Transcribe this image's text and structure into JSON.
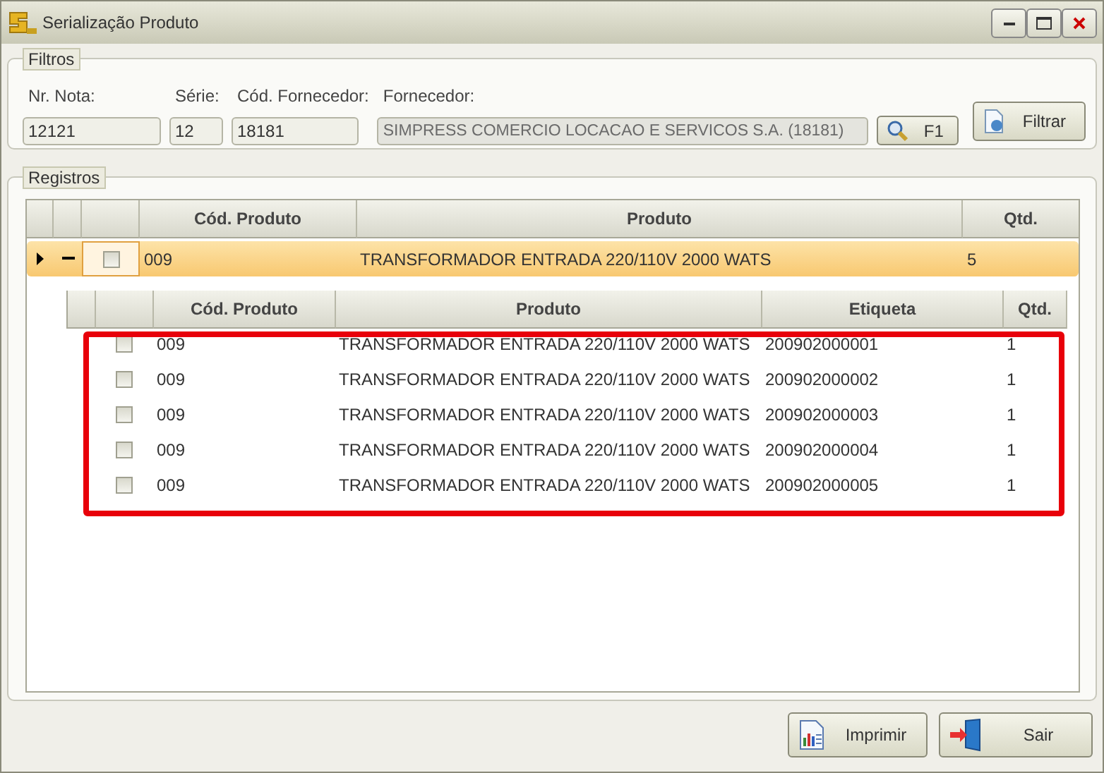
{
  "window": {
    "title": "Serialização Produto"
  },
  "filters": {
    "legend": "Filtros",
    "fields": [
      {
        "label": "Nr. Nota:",
        "value": "12121",
        "disabled": false
      },
      {
        "label": "Série:",
        "value": "12",
        "disabled": false
      },
      {
        "label": "Cód. Fornecedor:",
        "value": "18181",
        "disabled": false
      },
      {
        "label": "Fornecedor:",
        "value": "SIMPRESS COMERCIO LOCACAO E SERVICOS S.A. (18181)",
        "disabled": true
      }
    ],
    "lookup_button": "F1",
    "filter_button": "Filtrar"
  },
  "records": {
    "legend": "Registros",
    "columns": [
      "Cód. Produto",
      "Produto",
      "Qtd."
    ],
    "rows": [
      {
        "code": "009",
        "product": "TRANSFORMADOR ENTRADA 220/110V 2000 WATS",
        "qty": "5",
        "selected": true,
        "expanded": true,
        "checked": false,
        "child_columns": [
          "Cód. Produto",
          "Produto",
          "Etiqueta",
          "Qtd."
        ],
        "highlighted": true,
        "children": [
          {
            "code": "009",
            "product": "TRANSFORMADOR ENTRADA 220/110V 2000 WATS",
            "label": "200902000001",
            "qty": "1",
            "checked": false
          },
          {
            "code": "009",
            "product": "TRANSFORMADOR ENTRADA 220/110V 2000 WATS",
            "label": "200902000002",
            "qty": "1",
            "checked": false
          },
          {
            "code": "009",
            "product": "TRANSFORMADOR ENTRADA 220/110V 2000 WATS",
            "label": "200902000003",
            "qty": "1",
            "checked": false
          },
          {
            "code": "009",
            "product": "TRANSFORMADOR ENTRADA 220/110V 2000 WATS",
            "label": "200902000004",
            "qty": "1",
            "checked": false
          },
          {
            "code": "009",
            "product": "TRANSFORMADOR ENTRADA 220/110V 2000 WATS",
            "label": "200902000005",
            "qty": "1",
            "checked": false
          }
        ]
      }
    ]
  },
  "buttons": [
    "Imprimir",
    "Sair"
  ]
}
